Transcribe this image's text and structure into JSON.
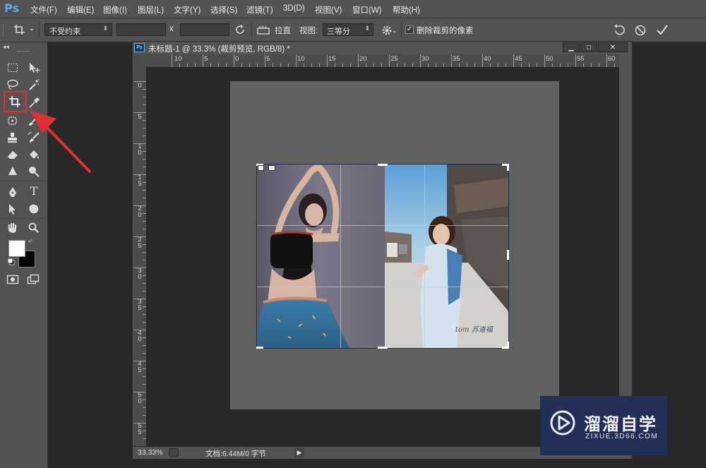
{
  "app": {
    "logo": "Ps"
  },
  "menu": [
    "文件(F)",
    "编辑(E)",
    "图像(I)",
    "图层(L)",
    "文字(Y)",
    "选择(S)",
    "滤镜(T)",
    "3D(D)",
    "视图(V)",
    "窗口(W)",
    "帮助(H)"
  ],
  "options": {
    "ratio_select": "不受约束",
    "x_sep": "x",
    "straighten_label": "拉直",
    "view_label": "视图:",
    "view_select": "三等分",
    "delete_cropped_label": "删除裁剪的像素",
    "delete_cropped_checked": true
  },
  "document": {
    "tab_title": "未标题-1 @ 33.3% (裁剪预览, RGB/8) *",
    "ruler_top": [
      "10",
      "5",
      "0",
      "5",
      "10",
      "15",
      "20",
      "25",
      "30",
      "35",
      "40",
      "45",
      "50",
      "55",
      "60"
    ],
    "ruler_left": [
      [
        "0"
      ],
      [
        "5"
      ],
      [
        "1",
        "0"
      ],
      [
        "1",
        "5"
      ],
      [
        "2",
        "0"
      ],
      [
        "2",
        "5"
      ],
      [
        "3",
        "0"
      ],
      [
        "3",
        "5"
      ],
      [
        "4",
        "0"
      ],
      [
        "4",
        "5"
      ],
      [
        "5",
        "0"
      ],
      [
        "5",
        "5"
      ]
    ],
    "photo_signature": "tom 苏道福"
  },
  "status": {
    "zoom": "33.33%",
    "doc_info": "文档:6.44M/0 字节"
  },
  "watermark": {
    "brand": "溜溜自学",
    "url": "ZIXUE.3D66.COM"
  },
  "colors": {
    "highlight": "#e03030",
    "accent_blue": "#5ea8e8",
    "watermark_bg": "#232f57"
  }
}
